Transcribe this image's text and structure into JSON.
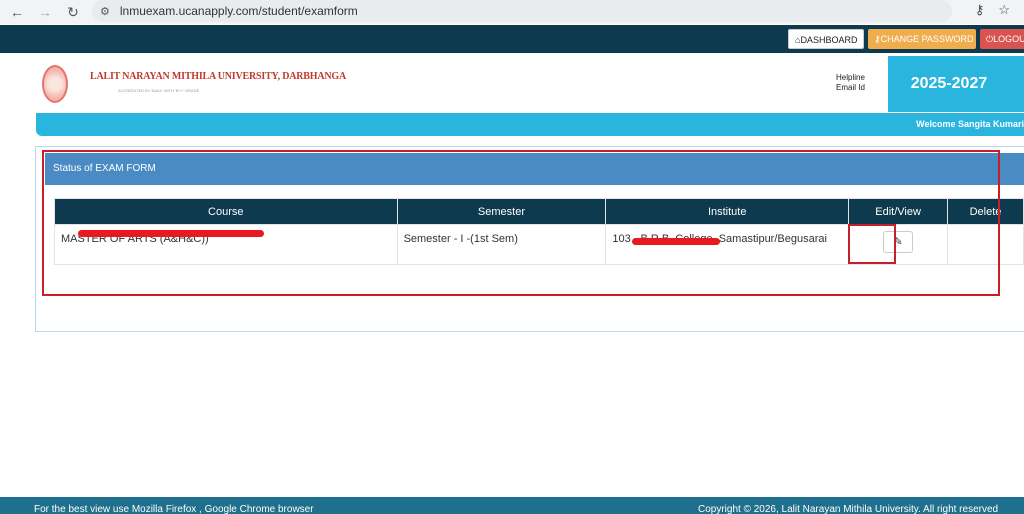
{
  "browser": {
    "url": "lnmuexam.ucanapply.com/student/examform",
    "back_icon": "arrow-left",
    "forward_icon": "arrow-right",
    "reload_icon": "reload"
  },
  "topnav": {
    "dashboard": "DASHBOARD",
    "change_password": "CHANGE PASSWORD",
    "logout": "LOGOUT"
  },
  "header": {
    "university": "LALIT NARAYAN MITHILA UNIVERSITY, DARBHANGA",
    "accreditation": "ACCREDITED BY NAAC WITH 'B++' GRADE",
    "helpline": "Helpline",
    "email": "Email Id",
    "session": "2025-2027"
  },
  "welcome": "Welcome Sangita Kumari",
  "panel": {
    "title": "Status of EXAM FORM",
    "columns": [
      "Course",
      "Semester",
      "Institute",
      "Edit/View",
      "Delete"
    ],
    "rows": [
      {
        "course": "MASTER OF ARTS (A&H&C))",
        "semester": "Semester - I -(1st Sem)",
        "institute": "103 - B.R.B. College, Samastipur/Begusarai"
      }
    ]
  },
  "footer": {
    "left": "For the best view use Mozilla Firefox , Google Chrome browser",
    "right": "Copyright © 2026, Lalit Narayan Mithila University. All right reserved"
  },
  "colors": {
    "navy": "#0d3a4e",
    "cyan": "#29b5dd",
    "panel_blue": "#4a8bc4",
    "highlight_red": "#c8202b"
  }
}
